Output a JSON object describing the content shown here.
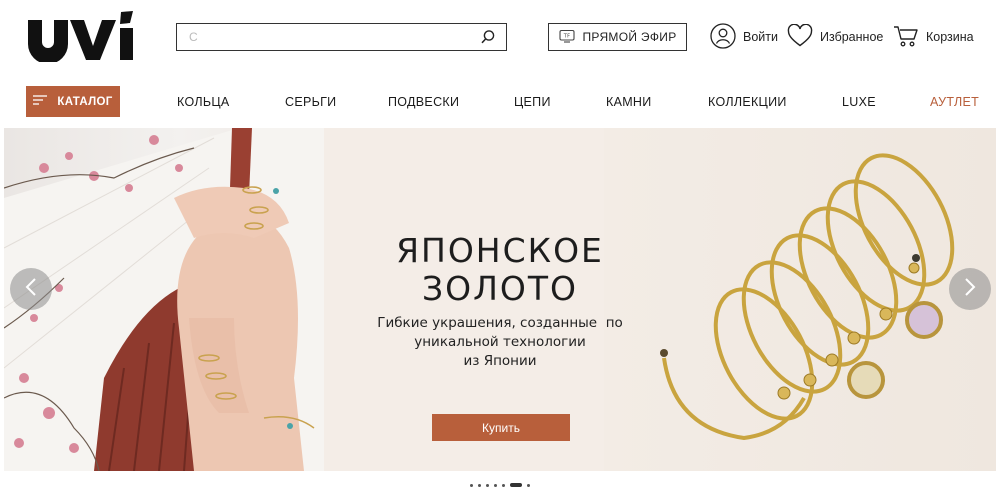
{
  "header": {
    "logo_text": "UVI",
    "search": {
      "placeholder": "С",
      "icon": "search-icon"
    },
    "live_button": {
      "label": "ПРЯМОЙ ЭФИР",
      "icon": "tv-icon"
    },
    "login": {
      "label": "Войти",
      "icon": "user-icon"
    },
    "favorites": {
      "label": "Избранное",
      "icon": "heart-icon"
    },
    "cart": {
      "label": "Корзина",
      "icon": "cart-icon"
    }
  },
  "nav": {
    "catalog_label": "КАТАЛОГ",
    "items": [
      {
        "label": "КОЛЬЦА"
      },
      {
        "label": "СЕРЬГИ"
      },
      {
        "label": "ПОДВЕСКИ"
      },
      {
        "label": "ЦЕПИ"
      },
      {
        "label": "КАМНИ"
      },
      {
        "label": "КОЛЛЕКЦИИ"
      },
      {
        "label": "LUXE"
      },
      {
        "label": "АУТЛЕТ"
      }
    ]
  },
  "banner": {
    "title_line1": "ЯПОНСКОЕ",
    "title_line2": "ЗОЛОТО",
    "subtitle_line1": "Гибкие украшения, созданные  по",
    "subtitle_line2": "уникальной технологии",
    "subtitle_line3": "из Японии",
    "cta_label": "Купить",
    "prev_icon": "chevron-left-icon",
    "next_icon": "chevron-right-icon"
  },
  "slider": {
    "slide_count": 7,
    "active_index": 5
  },
  "colors": {
    "accent": "#b85f3b",
    "text": "#222222",
    "banner_bg": "#f4ede7"
  }
}
